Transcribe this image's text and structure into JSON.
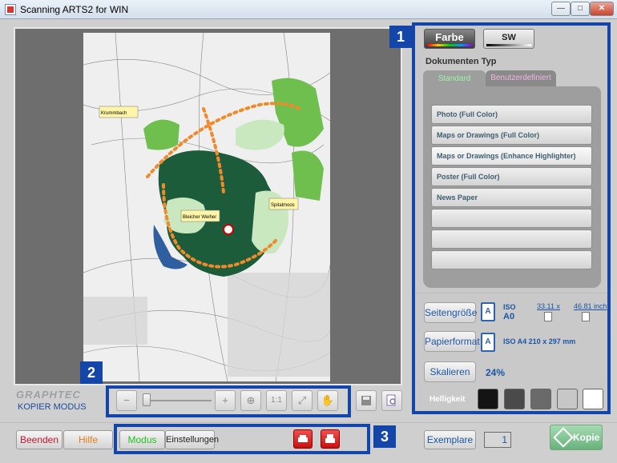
{
  "window": {
    "title": "Scanning ARTS2 for WIN",
    "minimize_glyph": "—",
    "maximize_glyph": "□",
    "close_glyph": "✕"
  },
  "preview": {
    "map_labels": [
      "Krummbach",
      "Bleicher Weiher",
      "Spitalmoos"
    ],
    "map_highlight_colors": {
      "forest": "#1c5c3b",
      "field": "#6fbf4f",
      "route": "#f08a2a",
      "water": "#2f5f9f"
    }
  },
  "branding": {
    "logo": "GRAPHTEC",
    "mode_label": "KOPIER MODUS"
  },
  "zoom_toolbar": {
    "zoom_out": "−",
    "zoom_in": "+",
    "zoom_rect": "⊕",
    "one_to_one": "1:1",
    "fit": "⤢",
    "pan": "✋",
    "save_icon": "save-icon",
    "preview_icon": "preview-icon"
  },
  "callouts": {
    "one": "1",
    "two": "2",
    "three": "3"
  },
  "color_mode": {
    "farbe": "Farbe",
    "sw": "SW"
  },
  "document_type": {
    "heading": "Dokumenten Typ",
    "tabs": [
      {
        "label": "Standard",
        "active": true
      },
      {
        "label": "Benutzerdefiniert",
        "active": false
      }
    ],
    "items": [
      "Photo (Full Color)",
      "Maps or Drawings (Full Color)",
      "Maps or Drawings (Enhance Highlighter)",
      "Poster (Full Color)",
      "News Paper",
      "",
      "",
      ""
    ],
    "selected_index": 2
  },
  "size": {
    "page_size_button": "Seitengröße",
    "page_icon_letter": "A",
    "iso_label": "ISO",
    "iso_value": "A0",
    "width_value": "33.11 x",
    "height_value": "46.81 inch",
    "paper_format_button": "Papierformat",
    "paper_format_value": "ISO A4 210 x 297 mm",
    "scale_button": "Skalieren",
    "scale_value": "24%",
    "brightness_label": "Helligkeit",
    "brightness_swatches": [
      "#141414",
      "#4a4a4a",
      "#6a6a6a",
      "#c7c7c7",
      "#ffffff"
    ]
  },
  "bottom": {
    "quit": "Beenden",
    "help": "Hilfe",
    "mode": "Modus",
    "settings": "Einstellungen",
    "copies_label": "Exemplare",
    "copies_value": "1",
    "copy_button": "Kopie"
  }
}
